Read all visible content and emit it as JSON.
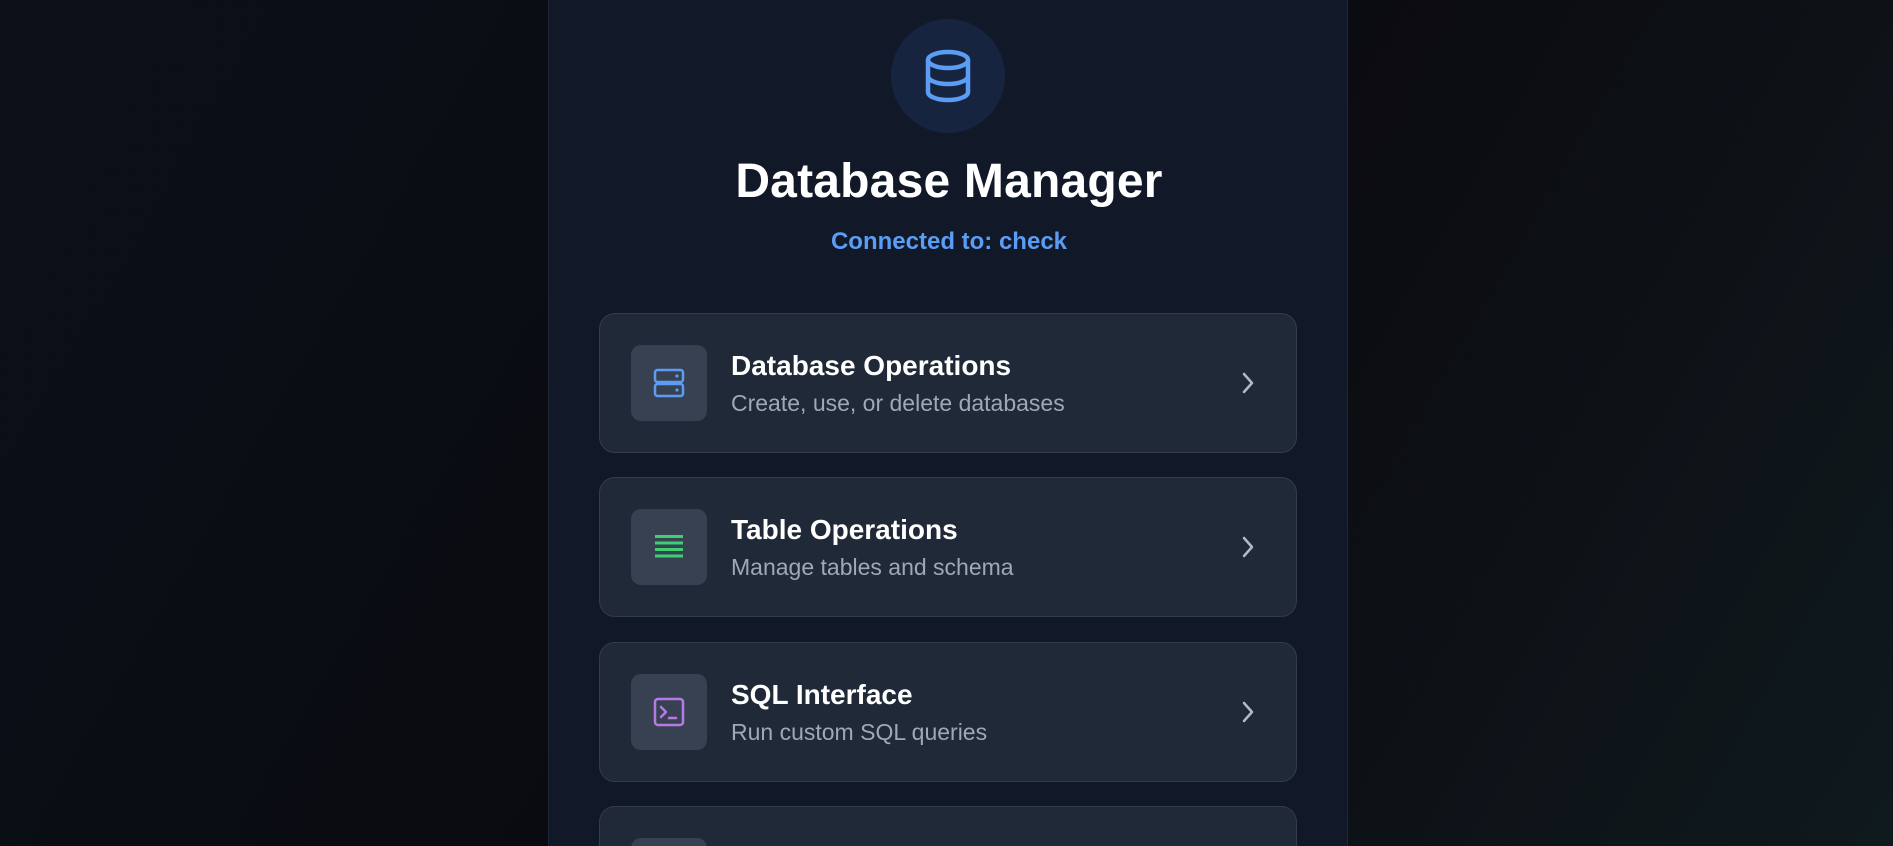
{
  "header": {
    "title": "Database Manager",
    "subtitle": "Connected to: check",
    "logo_icon": "database-icon"
  },
  "cards": [
    {
      "title": "Database Operations",
      "description": "Create, use, or delete databases",
      "icon": "server-icon",
      "icon_color": "#5b9df5"
    },
    {
      "title": "Table Operations",
      "description": "Manage tables and schema",
      "icon": "table-rows-icon",
      "icon_color": "#3ecf70"
    },
    {
      "title": "SQL Interface",
      "description": "Run custom SQL queries",
      "icon": "terminal-icon",
      "icon_color": "#b57ae6"
    },
    {
      "title": "",
      "description": "",
      "icon": "",
      "icon_color": ""
    }
  ],
  "colors": {
    "accent": "#5b9df5",
    "panel": "#111827",
    "card": "#1f2937"
  }
}
